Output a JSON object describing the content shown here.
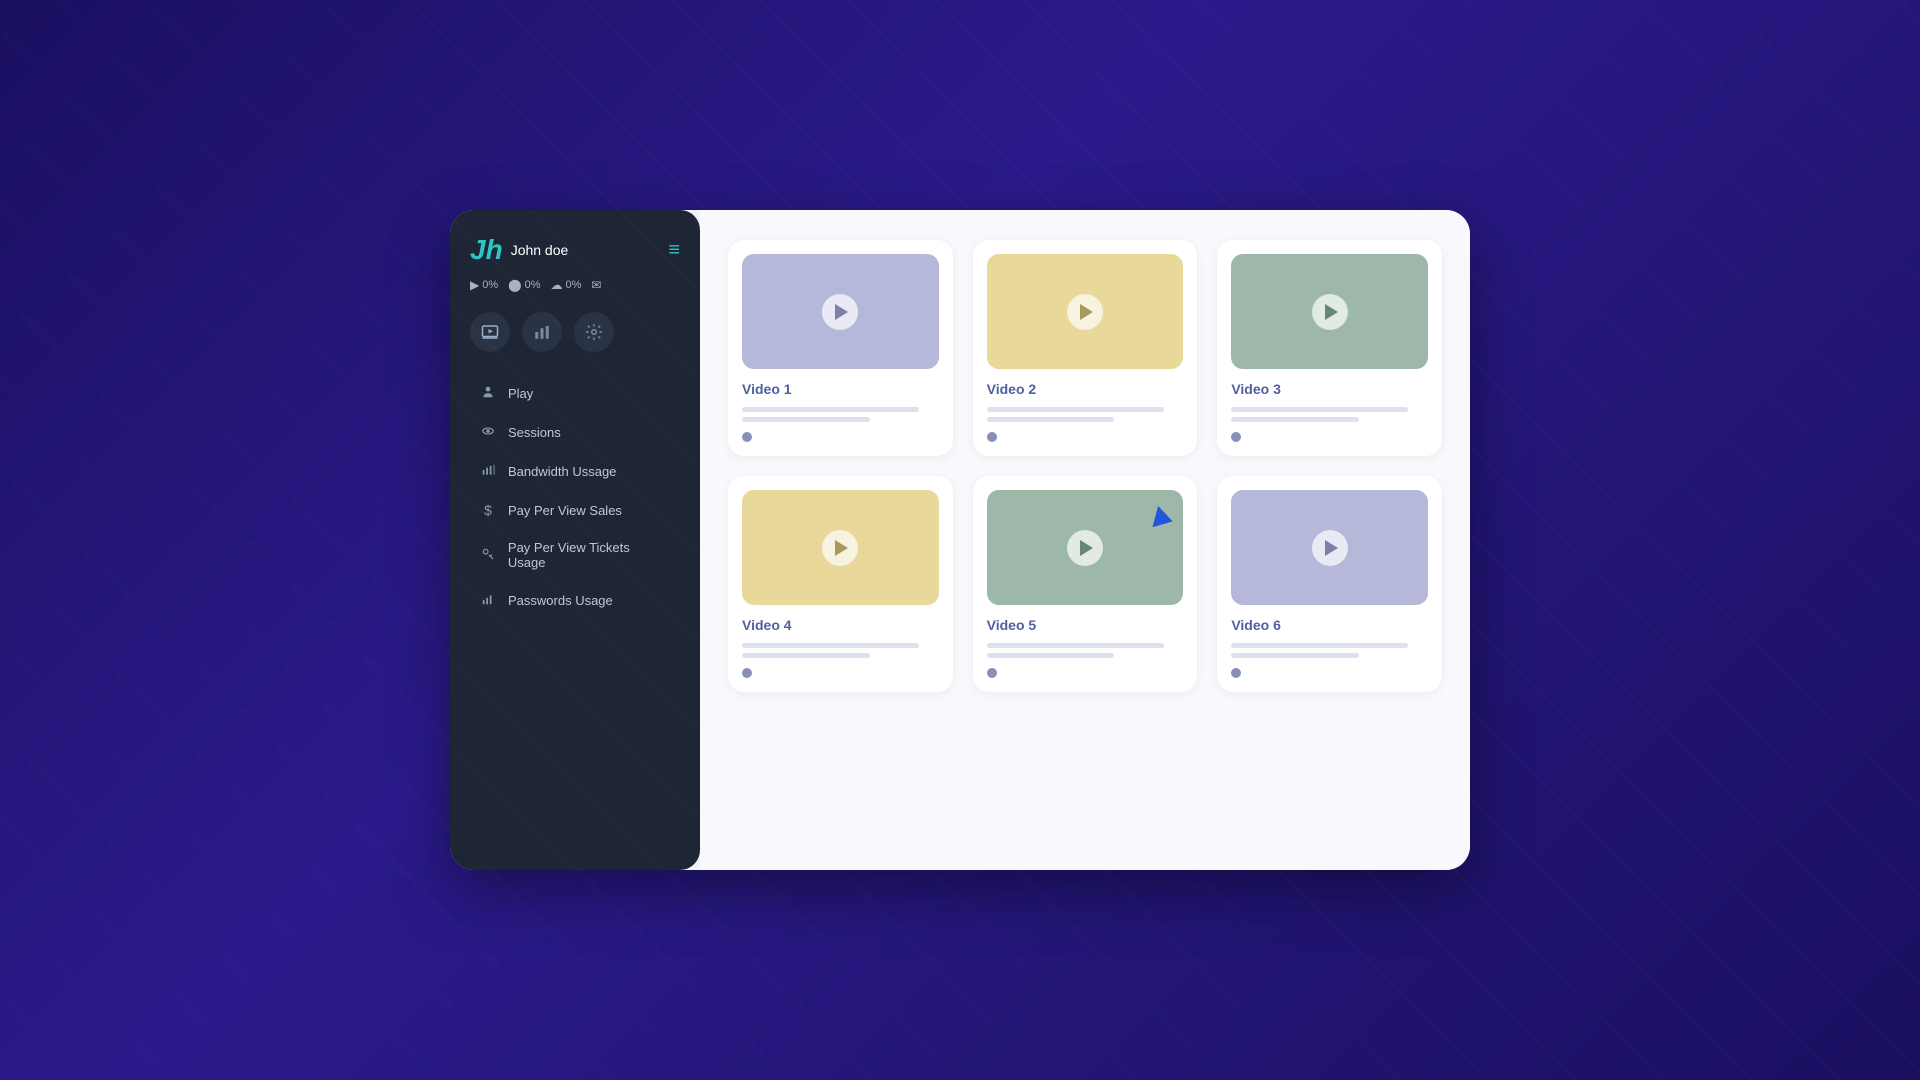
{
  "sidebar": {
    "logo": "Jh",
    "username": "John doe",
    "hamburger": "≡",
    "stats": [
      {
        "icon": "▶",
        "value": "0%",
        "id": "play-stat"
      },
      {
        "icon": "⬤",
        "value": "0%",
        "id": "circle-stat"
      },
      {
        "icon": "☁",
        "value": "0%",
        "id": "cloud-stat"
      }
    ],
    "email_icon": "✉",
    "icons": [
      {
        "id": "video-icon",
        "symbol": "▶",
        "active": true
      },
      {
        "id": "chart-icon",
        "symbol": "📊",
        "active": false
      },
      {
        "id": "settings-icon",
        "symbol": "⚙",
        "active": false
      }
    ],
    "nav_items": [
      {
        "id": "play",
        "icon": "👤",
        "label": "Play"
      },
      {
        "id": "sessions",
        "icon": "👁",
        "label": "Sessions"
      },
      {
        "id": "bandwidth",
        "icon": "📊",
        "label": "Bandwidth Ussage"
      },
      {
        "id": "ppv-sales",
        "icon": "$",
        "label": "Pay Per View Sales"
      },
      {
        "id": "ppv-tickets",
        "icon": "🔑",
        "label": "Pay Per View Tickets Usage"
      },
      {
        "id": "passwords",
        "icon": "📈",
        "label": "Passwords Usage"
      }
    ]
  },
  "videos": [
    {
      "id": "video1",
      "title": "Video 1",
      "color_class": "thumb-purple",
      "play_class": ""
    },
    {
      "id": "video2",
      "title": "Video 2",
      "color_class": "thumb-yellow",
      "play_class": "yellow"
    },
    {
      "id": "video3",
      "title": "Video 3",
      "color_class": "thumb-green",
      "play_class": "green"
    },
    {
      "id": "video4",
      "title": "Video 4",
      "color_class": "thumb-yellow",
      "play_class": "yellow"
    },
    {
      "id": "video5",
      "title": "Video 5",
      "color_class": "thumb-green",
      "play_class": "green"
    },
    {
      "id": "video6",
      "title": "Video 6",
      "color_class": "thumb-purple",
      "play_class": ""
    }
  ]
}
